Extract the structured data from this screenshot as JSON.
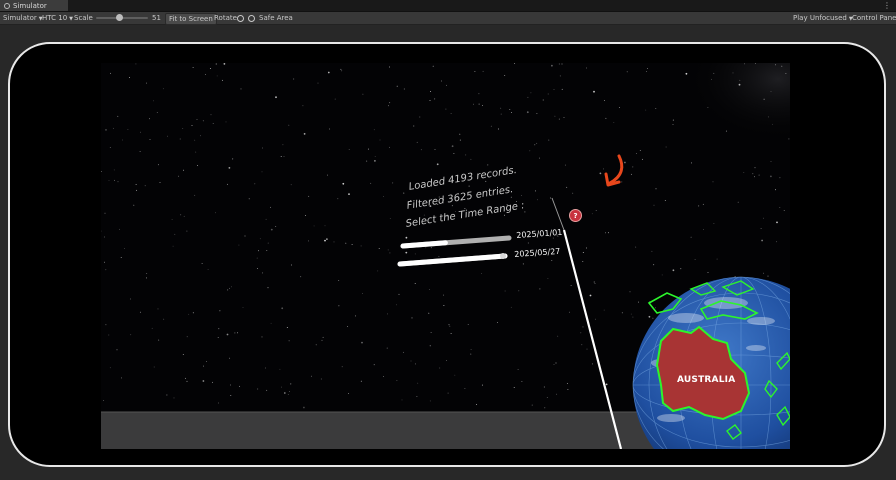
{
  "window": {
    "tab_title": "Simulator"
  },
  "toolbar": {
    "mode": "Simulator",
    "device": "HTC 10",
    "scale_label": "Scale",
    "scale_value": "51",
    "fit_to_screen": "Fit to Screen",
    "rotate": "Rotate",
    "safe_area": "Safe Area",
    "play_mode": "Play Unfocused",
    "control_panel": "Control Panel"
  },
  "scene": {
    "status_line1": "Loaded 4193 records.",
    "status_line2": "Filtered 3625 entries.",
    "status_line3": "Select the Time Range :",
    "start_date": "2025/01/01",
    "end_date": "2025/05/27",
    "start_slider_fraction": 0.4,
    "end_slider_fraction": 1.0,
    "help_symbol": "?",
    "globe_label": "AUSTRALIA"
  },
  "colors": {
    "annotation_arrow": "#e8471c",
    "coastline": "#2cf52c",
    "ocean": "#1f4fa0",
    "highlight_land": "#a83434"
  }
}
